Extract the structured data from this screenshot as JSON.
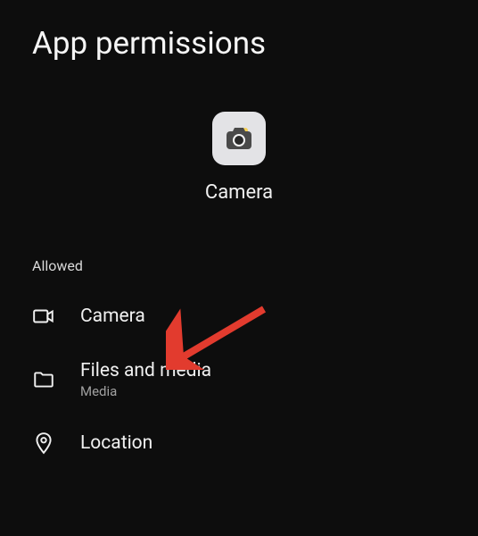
{
  "header": {
    "title": "App permissions"
  },
  "app": {
    "name": "Camera"
  },
  "sections": {
    "allowed": {
      "label": "Allowed",
      "items": [
        {
          "label": "Camera",
          "sublabel": null
        },
        {
          "label": "Files and media",
          "sublabel": "Media"
        },
        {
          "label": "Location",
          "sublabel": null
        }
      ]
    }
  },
  "colors": {
    "background": "#0d0d0d",
    "text": "#f0f0f0",
    "subtext": "#a0a0a0",
    "iconBg": "#e3e3e6",
    "arrow": "#e23b2e"
  }
}
